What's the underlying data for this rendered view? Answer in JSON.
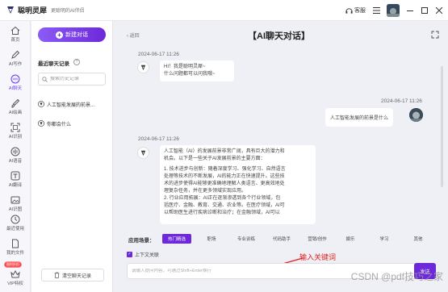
{
  "app": {
    "name": "聪明灵犀",
    "slogan": "更聪明的AI伴侣",
    "kefu_label": "客服"
  },
  "nav": {
    "items": [
      {
        "label": "首页",
        "icon": "home-icon"
      },
      {
        "label": "AI写作",
        "icon": "pen-icon"
      },
      {
        "label": "AI聊天",
        "icon": "chat-icon",
        "active": true
      },
      {
        "label": "AI绘画",
        "icon": "brush-icon"
      },
      {
        "label": "AI识别",
        "icon": "scan-icon"
      },
      {
        "label": "AI语音",
        "icon": "voice-icon"
      },
      {
        "label": "AI翻译",
        "icon": "translate-icon"
      },
      {
        "label": "AI识图",
        "icon": "image-icon"
      }
    ],
    "bottom_items": [
      {
        "label": "最近使用",
        "icon": "clock-icon"
      },
      {
        "label": "我的文件",
        "icon": "file-icon"
      },
      {
        "label": "VIP特权",
        "icon": "vip-icon"
      }
    ],
    "vip_badge": "限时折扣"
  },
  "sidebar": {
    "new_chat_label": "新建对话",
    "recent_title": "最近聊天记录",
    "search_placeholder": "搜索历史记录",
    "history": [
      {
        "label": "人工智能发展的前景..."
      },
      {
        "label": "你都会什么"
      }
    ],
    "clear_label": "清空聊天记录"
  },
  "main": {
    "back_label": "返回",
    "title": "【AI聊天对话】",
    "messages": [
      {
        "role": "bot",
        "time": "2024-06-17 11:26",
        "lines": [
          "HI！我是聪明灵犀~",
          "什么问题都可以问我哦~"
        ]
      },
      {
        "role": "user",
        "time": "2024-06-17 11:26",
        "text": "人工智能发展的前景是什么"
      },
      {
        "role": "bot",
        "time": "2024-06-17 11:26",
        "lines": [
          "人工智能（AI）的发展前景非常广阔，具有巨大的潜力和",
          "机会。以下是一些关于AI发展前景的主要方面：",
          "",
          "1. 技术进步与创新：随着深度学习、强化学习、自然语言",
          "处理等技术的不断发展，AI的能力正在快速提升。这些技",
          "术的进步使得AI能够更准确地理解人类语言、更高效地处",
          "理复杂任务，并在更多领域实现应用。",
          "2. 行业应用拓展：AI正在逐渐渗透到各个行业领域，包",
          "括医疗、金融、教育、交通、农业等。在医疗领域，AI可",
          "以帮助医生进行疾病诊断和治疗；在金融领域，AI可以"
        ]
      }
    ],
    "scenes_label": "应用场景：",
    "scenes": [
      "热门精选",
      "职场",
      "专业训练",
      "代码助手",
      "营销/创作",
      "娱乐",
      "学习",
      "其他"
    ],
    "context_label": "上下文关联",
    "input_placeholder": "请输入提问内容，可通过Shift+Enter换行",
    "send_label": "发送",
    "annotation": "输入关键词"
  },
  "watermark": "CSDN @pdf技巧之家"
}
